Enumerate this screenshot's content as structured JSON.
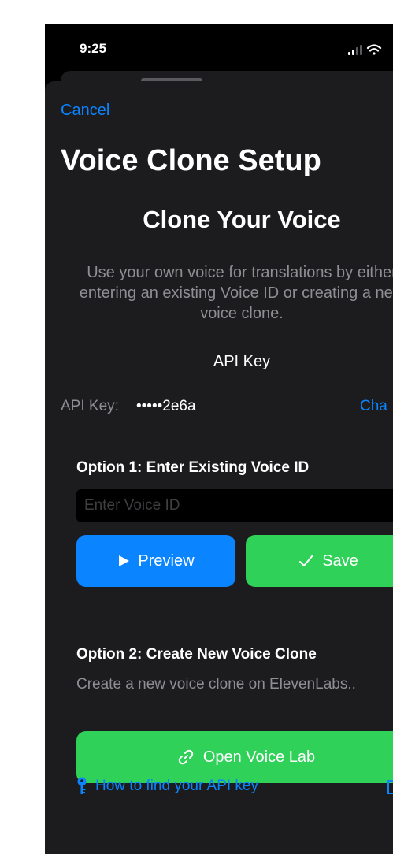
{
  "status_bar": {
    "time": "9:25"
  },
  "header": {
    "cancel_label": "Cancel",
    "title": "Voice Clone Setup"
  },
  "intro": {
    "heading": "Clone Your Voice",
    "description": "Use your own voice for translations by either entering an existing Voice ID or creating a new voice clone."
  },
  "api_key": {
    "section_label": "API Key",
    "label": "API Key:",
    "masked_value": "•••••2e6a",
    "change_label": "Cha"
  },
  "option1": {
    "title": "Option 1: Enter Existing Voice ID",
    "input_placeholder": "Enter Voice ID",
    "preview_label": "Preview",
    "save_label": "Save"
  },
  "option2": {
    "title": "Option 2: Create New Voice Clone",
    "description": "Create a new voice clone on ElevenLabs..",
    "open_lab_label": "Open Voice Lab"
  },
  "help": {
    "link_label": "How to find your API key"
  },
  "colors": {
    "accent_blue": "#0a84ff",
    "accent_green": "#30d158",
    "sheet_bg": "#1c1c1e",
    "muted_text": "#8e8e93"
  }
}
